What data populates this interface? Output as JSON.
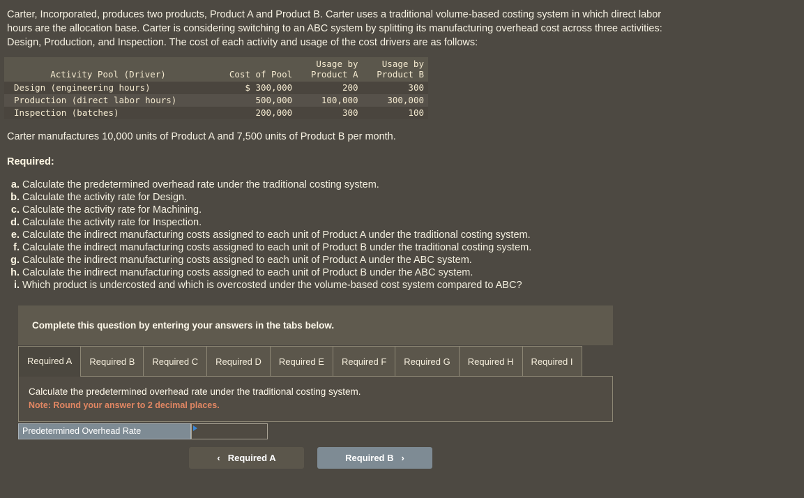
{
  "intro": "Carter, Incorporated, produces two products, Product A and Product B. Carter uses a traditional volume-based costing system in which direct labor hours are the allocation base. Carter is considering switching to an ABC system by splitting its manufacturing overhead cost across three activities: Design, Production, and Inspection. The cost of each activity and usage of the cost drivers are as follows:",
  "table": {
    "headers": {
      "activity": "Activity Pool (Driver)",
      "cost": "Cost of Pool",
      "usage_a_line1": "Usage by",
      "usage_a_line2": "Product A",
      "usage_b_line1": "Usage by",
      "usage_b_line2": "Product B"
    },
    "rows": [
      {
        "activity": "Design (engineering hours)",
        "cost": "$ 300,000",
        "usage_a": "200",
        "usage_b": "300"
      },
      {
        "activity": "Production (direct labor hours)",
        "cost": "500,000",
        "usage_a": "100,000",
        "usage_b": "300,000"
      },
      {
        "activity": "Inspection (batches)",
        "cost": "200,000",
        "usage_a": "300",
        "usage_b": "100"
      }
    ]
  },
  "units_line": "Carter manufactures 10,000 units of Product A and 7,500 units of Product B per month.",
  "required_heading": "Required:",
  "requirements": [
    {
      "marker": "a.",
      "text": "Calculate the predetermined overhead rate under the traditional costing system."
    },
    {
      "marker": "b.",
      "text": "Calculate the activity rate for Design."
    },
    {
      "marker": "c.",
      "text": "Calculate the activity rate for Machining."
    },
    {
      "marker": "d.",
      "text": "Calculate the activity rate for Inspection."
    },
    {
      "marker": "e.",
      "text": "Calculate the indirect manufacturing costs assigned to each unit of Product A under the traditional costing system."
    },
    {
      "marker": "f.",
      "text": "Calculate the indirect manufacturing costs assigned to each unit of Product B under the traditional costing system."
    },
    {
      "marker": "g.",
      "text": "Calculate the indirect manufacturing costs assigned to each unit of Product A under the ABC system."
    },
    {
      "marker": "h.",
      "text": "Calculate the indirect manufacturing costs assigned to each unit of Product B under the ABC system."
    },
    {
      "marker": "i.",
      "text": "Which product is undercosted and which is overcosted under the volume-based cost system compared to ABC?"
    }
  ],
  "card": {
    "banner": "Complete this question by entering your answers in the tabs below.",
    "tabs": [
      {
        "label": "Required A",
        "active": true
      },
      {
        "label": "Required B",
        "active": false
      },
      {
        "label": "Required C",
        "active": false
      },
      {
        "label": "Required D",
        "active": false
      },
      {
        "label": "Required E",
        "active": false
      },
      {
        "label": "Required F",
        "active": false
      },
      {
        "label": "Required G",
        "active": false
      },
      {
        "label": "Required H",
        "active": false
      },
      {
        "label": "Required I",
        "active": false
      }
    ],
    "panel": {
      "question": "Calculate the predetermined overhead rate under the traditional costing system.",
      "note": "Note: Round your answer to 2 decimal places."
    },
    "answer": {
      "label": "Predetermined Overhead Rate",
      "value": "",
      "placeholder": ""
    },
    "nav": {
      "prev_label": "Required A",
      "prev_chevron": "‹",
      "next_label": "Required B",
      "next_chevron": "›"
    }
  },
  "colors": {
    "page_bg": "#4d4942",
    "banner_bg": "#5f5a4e",
    "accent_blue": "#7e8b94",
    "note": "#e28763",
    "caret": "#3a86d6"
  }
}
